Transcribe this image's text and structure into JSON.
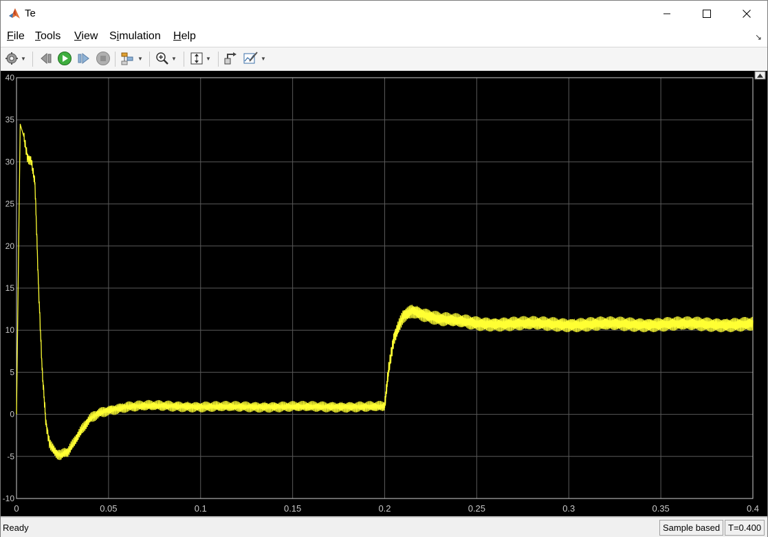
{
  "window": {
    "title": "Te"
  },
  "menu": {
    "file": {
      "accel": "F",
      "rest": "ile"
    },
    "tools": {
      "accel": "T",
      "rest": "ools"
    },
    "view": {
      "accel": "V",
      "rest": "iew"
    },
    "simulation": {
      "pre": "S",
      "accel": "i",
      "rest": "mulation"
    },
    "help": {
      "accel": "H",
      "rest": "elp"
    }
  },
  "toolbar": {
    "icons": [
      "gear-icon",
      "step-back-icon",
      "run-icon",
      "step-forward-icon",
      "stop-icon",
      "signal-select-icon",
      "zoom-in-icon",
      "fit-axes-icon",
      "highlight-block-icon",
      "style-icon"
    ]
  },
  "status": {
    "text": "Ready",
    "mode": "Sample based",
    "time": "T=0.400"
  },
  "colors": {
    "trace": "#ffff33",
    "plot_bg": "#000000",
    "grid": "#5a5a5a",
    "tick_text": "#c8c8c8"
  },
  "chart_data": {
    "type": "line",
    "title": "",
    "xlabel": "",
    "ylabel": "",
    "xlim": [
      0,
      0.4
    ],
    "ylim": [
      -10,
      40
    ],
    "xticks": [
      0,
      0.05,
      0.1,
      0.15,
      0.2,
      0.25,
      0.3,
      0.35,
      0.4
    ],
    "xtick_labels": [
      "0",
      "0.05",
      "0.1",
      "0.15",
      "0.2",
      "0.25",
      "0.3",
      "0.35",
      "0.4"
    ],
    "yticks": [
      -10,
      -5,
      0,
      5,
      10,
      15,
      20,
      25,
      30,
      35,
      40
    ],
    "ytick_labels": [
      "-10",
      "-5",
      "0",
      "5",
      "10",
      "15",
      "20",
      "25",
      "30",
      "35",
      "40"
    ],
    "grid": true,
    "series": [
      {
        "x": [
          0,
          0.002,
          0.004,
          0.006,
          0.008,
          0.01,
          0.012,
          0.014,
          0.016,
          0.018,
          0.02,
          0.022,
          0.024,
          0.026,
          0.028,
          0.03,
          0.035,
          0.04,
          0.045,
          0.05,
          0.06,
          0.07,
          0.08,
          0.1,
          0.12,
          0.15,
          0.18,
          0.199,
          0.2,
          0.202,
          0.205,
          0.21,
          0.215,
          0.22,
          0.23,
          0.25,
          0.3,
          0.35,
          0.4
        ],
        "y": [
          0,
          34.5,
          33.0,
          30.5,
          30.2,
          27.5,
          15.0,
          5.0,
          -1.0,
          -3.5,
          -4.2,
          -4.7,
          -4.9,
          -4.6,
          -4.5,
          -3.8,
          -2.0,
          -0.5,
          0.2,
          0.5,
          0.9,
          1.0,
          1.0,
          0.9,
          0.9,
          0.9,
          0.9,
          0.9,
          1.0,
          5.0,
          9.0,
          11.7,
          12.4,
          12.0,
          11.3,
          10.8,
          10.7,
          10.7,
          10.7
        ]
      }
    ]
  }
}
